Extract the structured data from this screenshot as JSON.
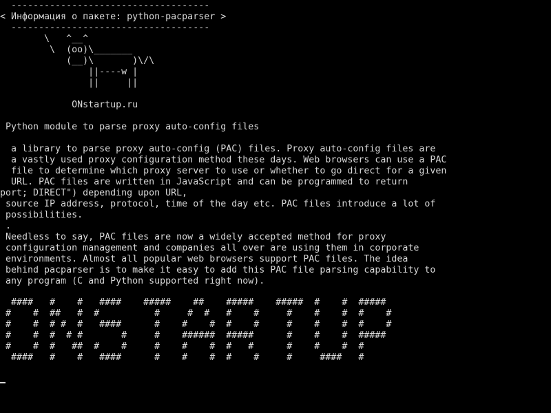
{
  "terminal": {
    "lines": [
      "  ------------------------------------",
      "< Информация о пакете: python-pacparser >",
      "  ------------------------------------",
      "        \\   ^__^",
      "         \\  (oo)\\_______",
      "            (__)\\       )\\/\\",
      "                ||----w |",
      "                ||     ||",
      "",
      "             ONstartup.ru",
      "",
      " Python module to parse proxy auto-config files",
      "",
      "  a library to parse proxy auto-config (PAC) files. Proxy auto-config files are",
      "  a vastly used proxy configuration method these days. Web browsers can use a PAC",
      "  file to determine which proxy server to use or whether to go direct for a given",
      "  URL. PAC files are written in JavaScript and can be programmed to return",
      "port; DIRECT\") depending upon URL,",
      " source IP address, protocol, time of the day etc. PAC files introduce a lot of",
      " possibilities.",
      " .",
      " Needless to say, PAC files are now a widely accepted method for proxy",
      " configuration management and companies all over are using them in corporate",
      " environments. Almost all popular web browsers support PAC files. The idea",
      " behind pacparser is to make it easy to add this PAC file parsing capability to",
      " any program (C and Python supported right now).",
      "",
      "  ####   #    #   ####    #####    ##    #####    #####  #    #  #####",
      " #    #  ##   #  #          #     #  #   #    #     #    #    #  #    #",
      " #    #  # #  #   ####      #    #    #  #    #     #    #    #  #    #",
      " #    #  #  # #       #     #    ######  #####      #    #    #  #####",
      " #    #  #   ##  #    #     #    #    #  #   #      #    #    #  #",
      "  ####   #    #   ####      #    #    #  #    #     #     ####   #"
    ]
  }
}
